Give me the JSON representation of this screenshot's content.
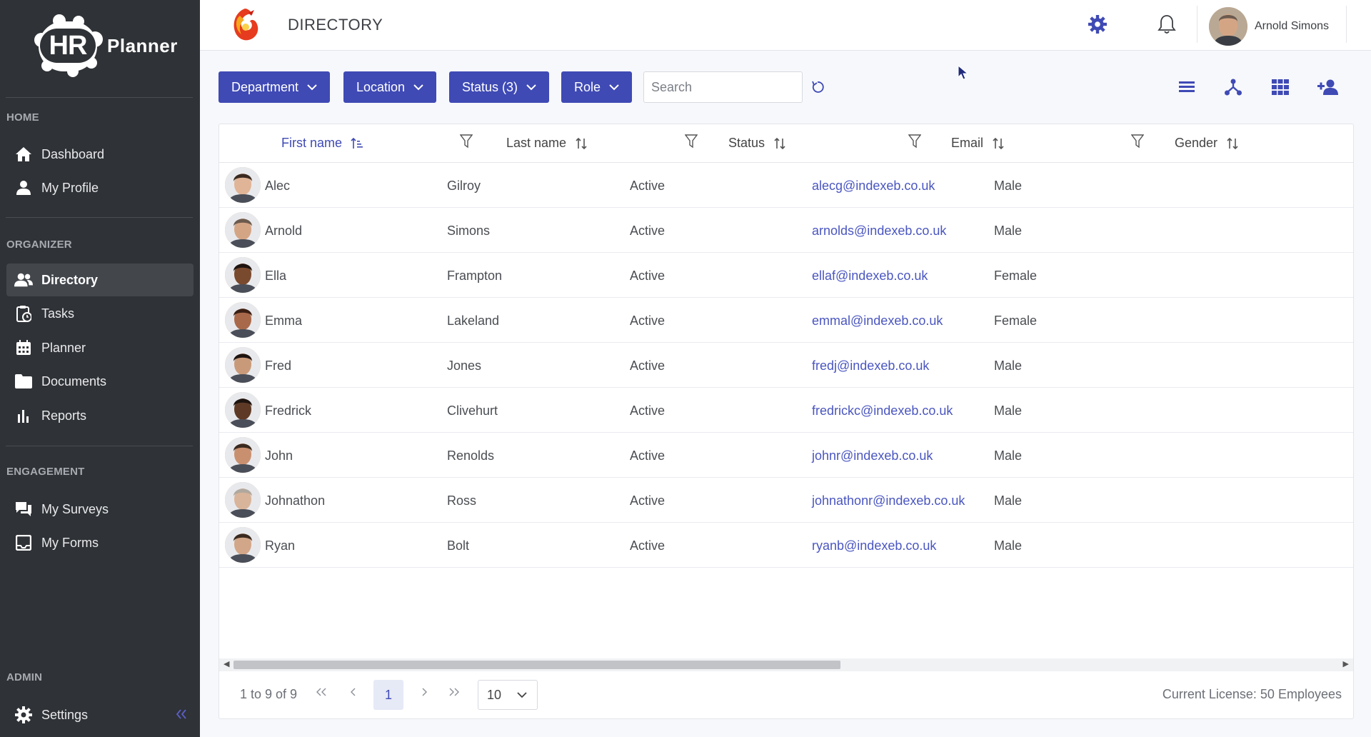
{
  "sidebar": {
    "logo_mark": "HR",
    "logo_text": "Planner",
    "sections": {
      "home": "HOME",
      "organizer": "ORGANIZER",
      "engagement": "ENGAGEMENT",
      "admin": "ADMIN"
    },
    "items": {
      "dashboard": "Dashboard",
      "my_profile": "My Profile",
      "directory": "Directory",
      "tasks": "Tasks",
      "planner": "Planner",
      "documents": "Documents",
      "reports": "Reports",
      "my_surveys": "My Surveys",
      "my_forms": "My Forms",
      "settings": "Settings"
    },
    "active_item": "Directory"
  },
  "header": {
    "title": "DIRECTORY",
    "user_name": "Arnold Simons"
  },
  "toolbar": {
    "filters": {
      "department": "Department",
      "location": "Location",
      "status": "Status (3)",
      "role": "Role"
    },
    "search_placeholder": "Search"
  },
  "table": {
    "columns": {
      "first_name": "First name",
      "last_name": "Last name",
      "status": "Status",
      "email": "Email",
      "gender": "Gender"
    },
    "rows": [
      {
        "first": "Alec",
        "last": "Gilroy",
        "status": "Active",
        "email": "alecg@indexeb.co.uk",
        "gender": "Male"
      },
      {
        "first": "Arnold",
        "last": "Simons",
        "status": "Active",
        "email": "arnolds@indexeb.co.uk",
        "gender": "Male"
      },
      {
        "first": "Ella",
        "last": "Frampton",
        "status": "Active",
        "email": "ellaf@indexeb.co.uk",
        "gender": "Female"
      },
      {
        "first": "Emma",
        "last": "Lakeland",
        "status": "Active",
        "email": "emmal@indexeb.co.uk",
        "gender": "Female"
      },
      {
        "first": "Fred",
        "last": "Jones",
        "status": "Active",
        "email": "fredj@indexeb.co.uk",
        "gender": "Male"
      },
      {
        "first": "Fredrick",
        "last": "Clivehurt",
        "status": "Active",
        "email": "fredrickc@indexeb.co.uk",
        "gender": "Male"
      },
      {
        "first": "John",
        "last": "Renolds",
        "status": "Active",
        "email": "johnr@indexeb.co.uk",
        "gender": "Male"
      },
      {
        "first": "Johnathon",
        "last": "Ross",
        "status": "Active",
        "email": "johnathonr@indexeb.co.uk",
        "gender": "Male"
      },
      {
        "first": "Ryan",
        "last": "Bolt",
        "status": "Active",
        "email": "ryanb@indexeb.co.uk",
        "gender": "Male"
      }
    ]
  },
  "pagination": {
    "range_text": "1 to 9 of 9",
    "current_page": "1",
    "page_size": "10",
    "license": "Current License: 50 Employees"
  },
  "colors": {
    "accent": "#3f4ab5",
    "sidebar_bg": "#2f3236",
    "link": "#4a56c0"
  }
}
